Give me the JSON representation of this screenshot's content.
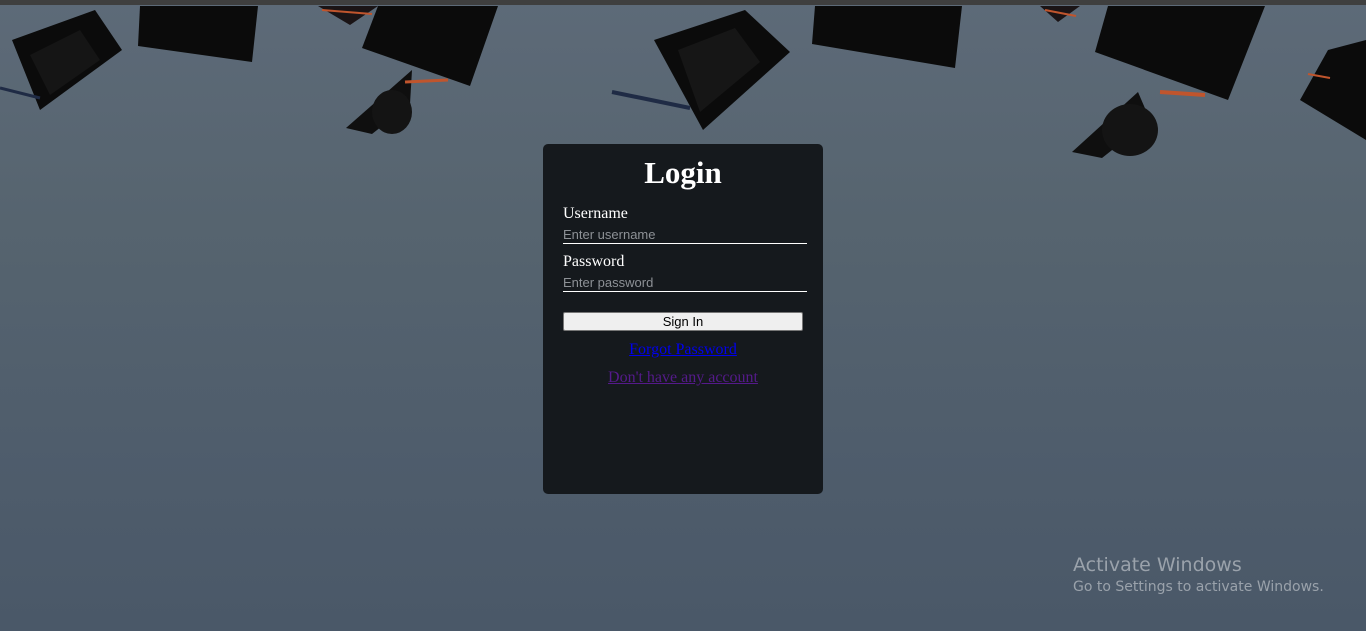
{
  "background": {
    "image": "graduation-caps-photo",
    "colors": {
      "sky": "#56646f",
      "caps": "#0b0b0b",
      "tassel": "#c0552d"
    }
  },
  "login": {
    "title": "Login",
    "username_label": "Username",
    "username_placeholder": "Enter username",
    "username_value": "",
    "password_label": "Password",
    "password_placeholder": "Enter password",
    "password_value": "",
    "signin_label": "Sign In",
    "forgot_link": "Forgot Password",
    "register_link": "Don't have any account",
    "colors": {
      "panel": "#15191d",
      "text": "#ffffff",
      "link": "#0000ee",
      "visited_link": "#551a8b"
    }
  },
  "watermark": {
    "title": "Activate Windows",
    "subtitle": "Go to Settings to activate Windows."
  }
}
